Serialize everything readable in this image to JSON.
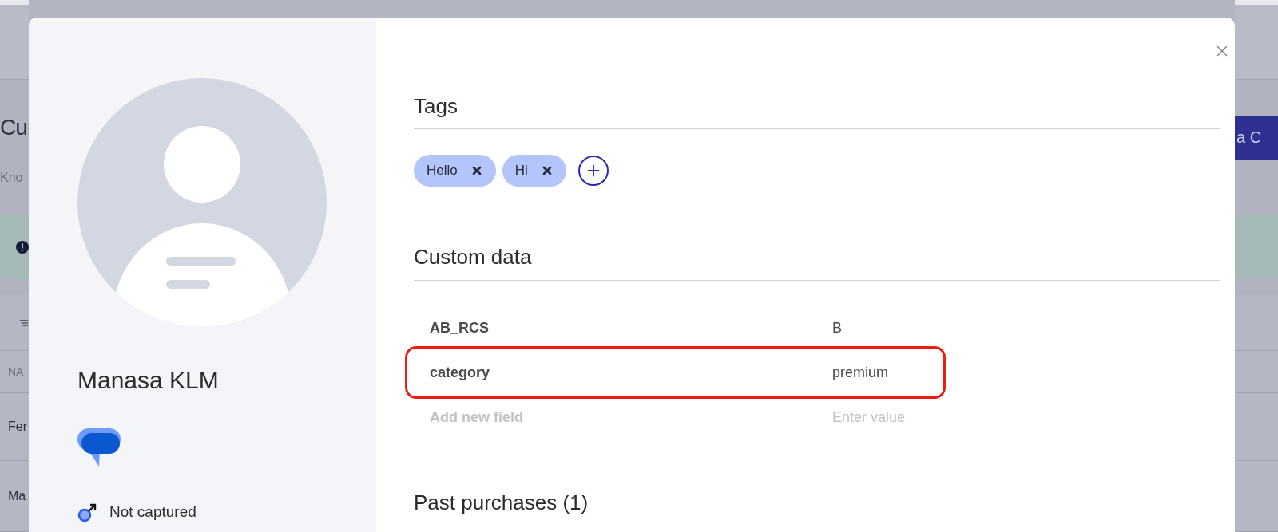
{
  "background": {
    "title": "Cu",
    "subtitle": "Kno",
    "table_header": "NA",
    "rows": [
      "Fer",
      "Ma"
    ],
    "button": "a C"
  },
  "profile": {
    "name": "Manasa KLM",
    "gender": "Not captured"
  },
  "tags": {
    "title": "Tags",
    "items": [
      {
        "label": "Hello"
      },
      {
        "label": "Hi"
      }
    ]
  },
  "custom_data": {
    "title": "Custom data",
    "fields": [
      {
        "key": "AB_RCS",
        "value": "B",
        "highlighted": false
      },
      {
        "key": "category",
        "value": "premium",
        "highlighted": true
      }
    ],
    "new_field": {
      "key_placeholder": "Add new field",
      "value_placeholder": "Enter value"
    }
  },
  "past_purchases": {
    "title": "Past purchases (1)"
  }
}
